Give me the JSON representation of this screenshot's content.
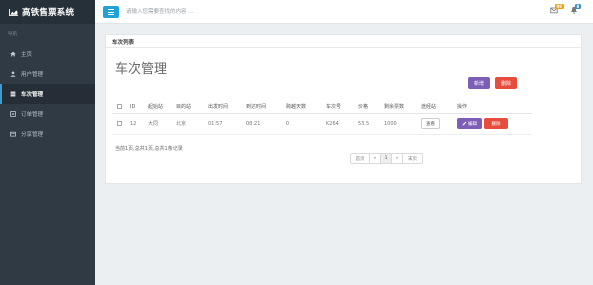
{
  "app": {
    "title": "高铁售票系统"
  },
  "sidebar": {
    "section_label": "导航",
    "items": [
      {
        "label": "主页",
        "icon": "home-icon"
      },
      {
        "label": "用户管理",
        "icon": "user-icon"
      },
      {
        "label": "车次管理",
        "icon": "train-icon",
        "active": true
      },
      {
        "label": "订单管理",
        "icon": "list-icon"
      },
      {
        "label": "分享管理",
        "icon": "share-icon"
      }
    ]
  },
  "topbar": {
    "search_placeholder": "请输入您需要查找的内容 ...",
    "mail_badge": "99",
    "bell_badge": "8",
    "colors": {
      "mail_badge": "#f39c12",
      "bell_badge": "#3c8dbc",
      "menu": "#1fa3d6"
    }
  },
  "panel": {
    "header": "车次列表",
    "title": "车次管理",
    "add_label": "新增",
    "delete_label": "删除"
  },
  "table": {
    "headers": [
      "ID",
      "起始站",
      "目的站",
      "出发时间",
      "到达时间",
      "跨越天数",
      "车次号",
      "价格",
      "剩余票数",
      "途经站",
      "操作"
    ],
    "rows": [
      {
        "id": "12",
        "from": "大同",
        "to": "北京",
        "depart": "01:57",
        "arrive": "08:21",
        "days": "0",
        "train_no": "K264",
        "price": "53.5",
        "remaining": "1000",
        "view_label": "查看",
        "edit_label": "编辑",
        "remove_label": "删除"
      }
    ]
  },
  "summary": "当前1页,总共1页,总共1条记录",
  "pager": {
    "first": "首页",
    "prev": "«",
    "current": "1",
    "next": "»",
    "last": "末页"
  }
}
